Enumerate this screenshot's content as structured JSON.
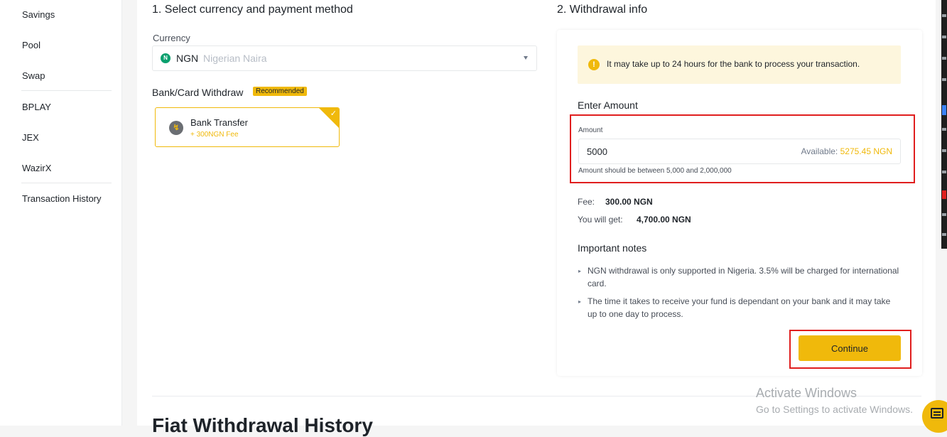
{
  "sidebar": {
    "items": [
      "Savings",
      "Pool",
      "Swap",
      "BPLAY",
      "JEX",
      "WazirX",
      "Transaction History"
    ]
  },
  "section1": {
    "title": "1. Select currency and payment method",
    "currency_label": "Currency",
    "currency_code": "NGN",
    "currency_name": "Nigerian Naira",
    "currency_icon_text": "N",
    "bank_label": "Bank/Card Withdraw",
    "recommended_badge": "Recommended",
    "method_name": "Bank Transfer",
    "method_fee": "+ 300NGN Fee"
  },
  "section2": {
    "title": "2. Withdrawal info",
    "notice_text": "It may take up to 24 hours for the bank to process your transaction.",
    "enter_amount_title": "Enter Amount",
    "amount_label": "Amount",
    "amount_value": "5000",
    "available_label": "Available:",
    "available_value": "5275.45 NGN",
    "amount_hint": "Amount should be between 5,000 and 2,000,000",
    "fee_label": "Fee:",
    "fee_value": "300.00 NGN",
    "get_label": "You will get:",
    "get_value": "4,700.00 NGN",
    "notes_title": "Important notes",
    "notes": [
      "NGN withdrawal is only supported in Nigeria. 3.5% will be charged for international card.",
      "The time it takes to receive your fund is dependant on your bank and it may take up to one day to process."
    ],
    "continue_label": "Continue"
  },
  "history_title": "Fiat Withdrawal History",
  "watermark": {
    "line1": "Activate Windows",
    "line2": "Go to Settings to activate Windows."
  },
  "colors": {
    "accent": "#f0b90b",
    "highlight_box": "#e01e1e",
    "ngn_icon": "#0aa06e"
  },
  "icons": [
    "ngn-coin-icon",
    "chevron-down-icon",
    "bank-transfer-icon",
    "check-icon",
    "warning-icon",
    "bullet-icon",
    "chat-icon"
  ]
}
